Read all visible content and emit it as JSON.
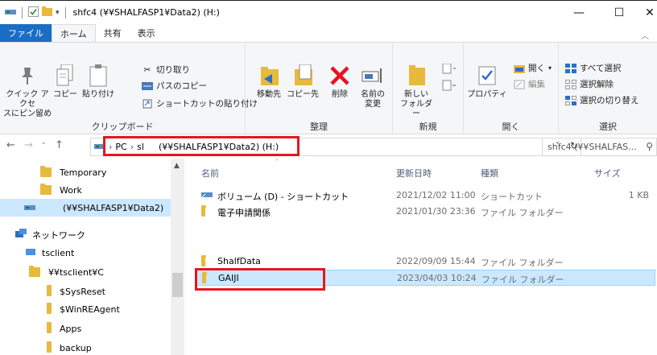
{
  "window": {
    "title": "shfc4 (¥¥SHALFASP1¥Data2) (H:)",
    "minimize": "—",
    "maximize": "☐",
    "close": "✕"
  },
  "ribbon_tabs": [
    "ファイル",
    "ホーム",
    "共有",
    "表示"
  ],
  "clipboard": {
    "pin_label_1": "クイック アクセ",
    "pin_label_2": "スにピン留め",
    "copy": "コピー",
    "paste": "貼り付け",
    "cut": "切り取り",
    "copy_path": "パスのコピー",
    "paste_shortcut": "ショートカットの貼り付け",
    "group": "クリップボード"
  },
  "organize": {
    "move_to": "移動先",
    "copy_to": "コピー先",
    "delete": "削除",
    "rename_1": "名前の",
    "rename_2": "変更",
    "group": "整理"
  },
  "new": {
    "new_folder_1": "新しい",
    "new_folder_2": "フォルダー",
    "group": "新規"
  },
  "open": {
    "properties": "プロパティ",
    "open": "開く",
    "edit": "編集",
    "group": "開く"
  },
  "select": {
    "select_all": "すべて選択",
    "select_none": "選択解除",
    "invert": "選択の切り替え",
    "group": "選択"
  },
  "address": {
    "pc": "PC",
    "sl": "sl",
    "drive": "(¥¥SHALFASP1¥Data2) (H:)",
    "search_placeholder": "shfc4 (¥¥SHALFAS..."
  },
  "nav": {
    "temporary": "Temporary",
    "work": "Work",
    "drive": "(¥¥SHALFASP1¥Data2)",
    "network": "ネットワーク",
    "tsclient": "tsclient",
    "tsclient_c": "¥¥tsclient¥C",
    "sysreset": "$SysReset",
    "winre": "$WinREAgent",
    "apps": "Apps",
    "backup": "backup"
  },
  "columns": {
    "name": "名前",
    "date": "更新日時",
    "type": "種類",
    "size": "サイズ"
  },
  "files": [
    {
      "name": "ボリューム (D) - ショートカット",
      "date": "2021/12/02 11:00",
      "type": "ショートカット",
      "size": "1 KB"
    },
    {
      "name": "電子申請関係",
      "date": "2021/01/30 23:36",
      "type": "ファイル フォルダー",
      "size": ""
    },
    {
      "name": "ShalfData",
      "date": "2022/09/09 15:44",
      "type": "ファイル フォルダー",
      "size": ""
    },
    {
      "name": "GAIJI",
      "date": "2023/04/03 10:24",
      "type": "ファイル フォルダー",
      "size": ""
    }
  ],
  "colors": {
    "file_tab": "#1a6dc5",
    "selection": "#cce8ff",
    "highlight_box": "#e8141e",
    "folder": "#e8b93a"
  }
}
